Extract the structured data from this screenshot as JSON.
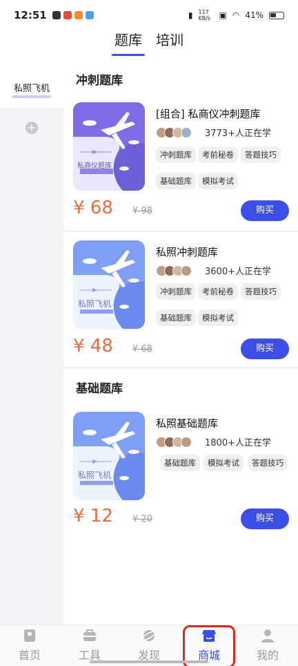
{
  "status_bar": {
    "time": "12:51",
    "net_speed": "117 KB/s",
    "battery": "41%"
  },
  "top_tabs": [
    {
      "label": "题库",
      "active": true
    },
    {
      "label": "培训",
      "active": false
    }
  ],
  "sidebar": {
    "categories": [
      {
        "label": "私照飞机",
        "selected": true
      }
    ],
    "add_icon": "plus-circle-icon"
  },
  "sections": [
    {
      "title": "冲刺题库",
      "products": [
        {
          "title": "[组合] 私商仪冲刺题库",
          "cover_text": "私商仪题库",
          "learners": "3773+人正在学",
          "tags": [
            "冲刺题库",
            "考前秘卷",
            "答题技巧",
            "基础题库",
            "模拟考试"
          ],
          "price": "¥ 68",
          "old_price": "¥ 98",
          "buy_label": "购买"
        },
        {
          "title": "私照冲刺题库",
          "cover_text": "私照飞机",
          "learners": "3600+人正在学",
          "tags": [
            "冲刺题库",
            "考前秘卷",
            "答题技巧",
            "基础题库",
            "模拟考试"
          ],
          "price": "¥ 48",
          "old_price": "¥ 68",
          "buy_label": "购买"
        }
      ]
    },
    {
      "title": "基础题库",
      "products": [
        {
          "title": "私照基础题库",
          "cover_text": "私照飞机",
          "learners": "1800+人正在学",
          "tags": [
            "基础题库",
            "模拟考试",
            "答题技巧"
          ],
          "price": "¥ 12",
          "old_price": "¥ 20",
          "buy_label": "购买"
        }
      ]
    }
  ],
  "bottom_nav": [
    {
      "label": "首页",
      "icon": "book-icon",
      "active": false
    },
    {
      "label": "工具",
      "icon": "toolbox-icon",
      "active": false
    },
    {
      "label": "发现",
      "icon": "planet-icon",
      "active": false
    },
    {
      "label": "商城",
      "icon": "store-icon",
      "active": true
    },
    {
      "label": "我的",
      "icon": "person-icon",
      "active": false
    }
  ],
  "colors": {
    "accent": "#3d4ee6",
    "price": "#f06a3c",
    "highlight": "#e1261e"
  }
}
